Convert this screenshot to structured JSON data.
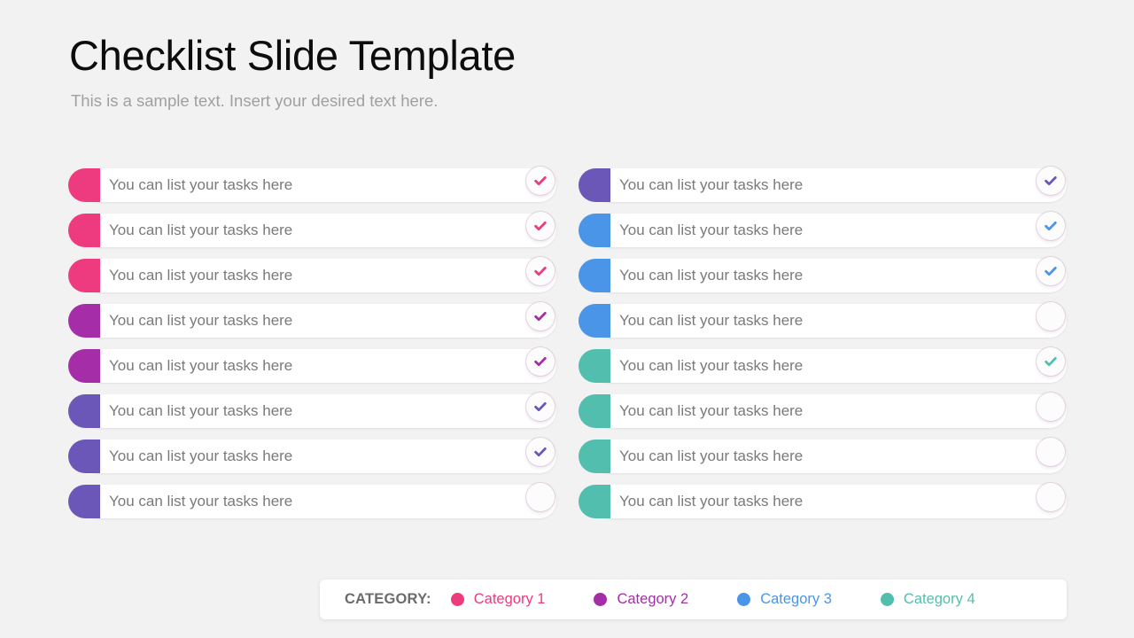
{
  "header": {
    "title": "Checklist Slide Template",
    "subtitle": "This is a sample text. Insert your desired text here."
  },
  "palette": {
    "pink": "#ee3a7e",
    "purple": "#a52ea8",
    "indigo": "#6a57b8",
    "blue": "#4a95e8",
    "teal": "#52bfae",
    "background": "#f2f2f2",
    "row_background": "#ffffff",
    "label_text": "#7a7a7a",
    "title_text": "#0d0d0d",
    "subtitle_text": "#a0a0a0"
  },
  "checklist": {
    "left_column": [
      {
        "label": "You can list your tasks here",
        "color": "#ee3a7e",
        "checked": true
      },
      {
        "label": "You can list your tasks here",
        "color": "#ee3a7e",
        "checked": true
      },
      {
        "label": "You can list your tasks here",
        "color": "#ee3a7e",
        "checked": true
      },
      {
        "label": "You can list your tasks here",
        "color": "#a52ea8",
        "checked": true
      },
      {
        "label": "You can list your tasks here",
        "color": "#a52ea8",
        "checked": true
      },
      {
        "label": "You can list your tasks here",
        "color": "#6a57b8",
        "checked": true
      },
      {
        "label": "You can list your tasks here",
        "color": "#6a57b8",
        "checked": true
      },
      {
        "label": "You can list your tasks here",
        "color": "#6a57b8",
        "checked": false
      }
    ],
    "right_column": [
      {
        "label": "You can list your tasks here",
        "color": "#6a57b8",
        "checked": true
      },
      {
        "label": "You can list your tasks here",
        "color": "#4a95e8",
        "checked": true
      },
      {
        "label": "You can list your tasks here",
        "color": "#4a95e8",
        "checked": true
      },
      {
        "label": "You can list your tasks here",
        "color": "#4a95e8",
        "checked": false
      },
      {
        "label": "You can list your tasks here",
        "color": "#52bfae",
        "checked": true
      },
      {
        "label": "You can list your tasks here",
        "color": "#52bfae",
        "checked": false
      },
      {
        "label": "You can list your tasks here",
        "color": "#52bfae",
        "checked": false
      },
      {
        "label": "You can list your tasks here",
        "color": "#52bfae",
        "checked": false
      }
    ]
  },
  "legend": {
    "title": "CATEGORY:",
    "items": [
      {
        "label": "Category 1",
        "color": "#ee3a7e"
      },
      {
        "label": "Category 2",
        "color": "#a52ea8"
      },
      {
        "label": "Category 3",
        "color": "#4a95e8"
      },
      {
        "label": "Category 4",
        "color": "#52bfae"
      }
    ]
  }
}
